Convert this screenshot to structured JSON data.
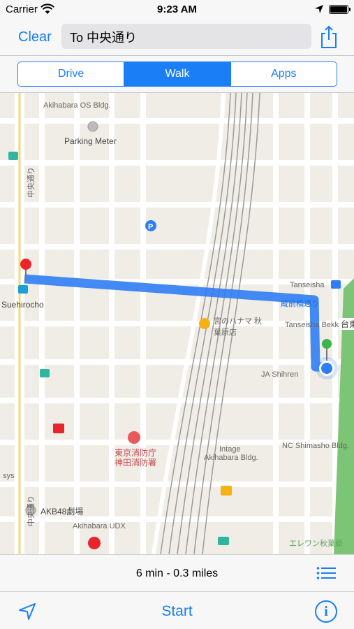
{
  "status_bar": {
    "carrier": "Carrier",
    "time": "9:23 AM",
    "wifi_icon": "wifi-icon",
    "location_icon": "location-arrow-icon",
    "battery_icon": "battery-icon"
  },
  "nav": {
    "clear_label": "Clear",
    "destination": "To 中央通り",
    "share_icon": "share-icon"
  },
  "modes": {
    "items": [
      "Drive",
      "Walk",
      "Apps"
    ],
    "selected": "Walk"
  },
  "map": {
    "labels": {
      "akihabara_os": "Akihabara OS Bldg.",
      "parking_meter": "Parking Meter",
      "suehirocho": "Suehirocho",
      "tanseisha": "Tanseisha",
      "tanseisha_bekkan": "Tanseisha Bekkan",
      "shop_jp": "宮のハナマ 秋葉原店",
      "route_jp": "蔵前橋通り",
      "ja_shihren": "JA Shihren",
      "nc_shimasho": "NC Shimasho Bldg.",
      "fire_station_jp1": "東京消防庁",
      "fire_station_jp2": "神田消防署",
      "intage": "Intage",
      "akihabara_bldg": "Akihabara Bldg.",
      "akb48": "AKB48劇場",
      "akihabara_udx": "Akihabara UDX",
      "chuo_dori": "中央通り",
      "chuo_dori_2": "中央通り",
      "daito": "台東",
      "elevenses": "エレワン秋葉原",
      "sys": "sys"
    },
    "colors": {
      "route": "#2f7df4",
      "road": "#ffffff",
      "block": "#e8e4db",
      "rail": "#9a9a9a",
      "park": "#7cc576"
    }
  },
  "summary": {
    "eta": "6 min - 0.3 miles",
    "list_icon": "list-icon"
  },
  "toolbar": {
    "locate_icon": "location-arrow-icon",
    "start_label": "Start",
    "info_icon": "info-icon",
    "info_glyph": "i"
  }
}
